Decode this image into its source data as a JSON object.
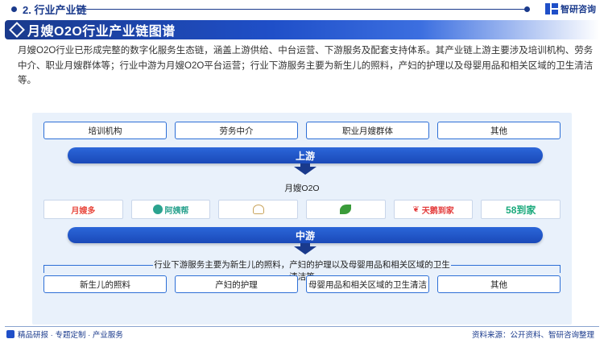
{
  "header": {
    "section_title": "2. 行业产业链",
    "brand_name": "智研咨询"
  },
  "banner": {
    "title": "月嫂O2O行业产业链图谱"
  },
  "intro": "月嫂O2O行业已形成完整的数字化服务生态链，涵盖上游供给、中台运营、下游服务及配套支持体系。其产业链上游主要涉及培训机构、劳务中介、职业月嫂群体等；行业中游为月嫂O2O平台运营；行业下游服务主要为新生儿的照料，产妇的护理以及母婴用品和相关区域的卫生清洁等。",
  "upstream": {
    "items": [
      "培训机构",
      "劳务中介",
      "职业月嫂群体",
      "其他"
    ],
    "stage_label": "上游"
  },
  "midstream": {
    "title": "月嫂O2O",
    "logos": [
      {
        "text": "月嫂多",
        "color": "#e8463b"
      },
      {
        "text": "阿姨帮",
        "color": "#2ba38f"
      },
      {
        "text": "",
        "color": "#c9a45c"
      },
      {
        "text": "",
        "color": "#3a9b3a"
      },
      {
        "text": "天鹅到家",
        "color": "#e33a3a"
      },
      {
        "text": "58到家",
        "color": "#19a97b"
      }
    ],
    "stage_label": "中游"
  },
  "downstream": {
    "summary": "行业下游服务主要为新生儿的照料，产妇的护理以及母婴用品和相关区域的卫生清洁等",
    "items": [
      "新生儿的照料",
      "产妇的护理",
      "母婴用品和相关区域的卫生清洁",
      "其他"
    ]
  },
  "footer": {
    "left": "精品研报 · 专题定制 · 产业服务",
    "right": "资料来源：公开资料、智研咨询整理"
  }
}
